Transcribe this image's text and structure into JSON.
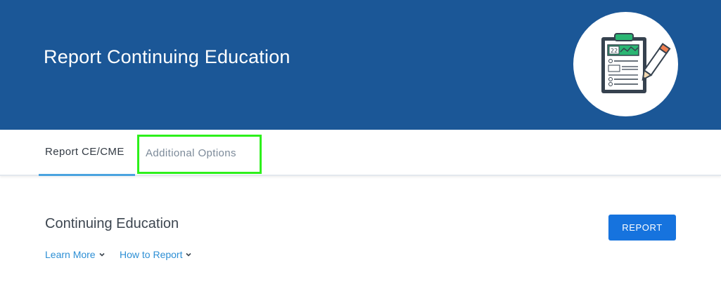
{
  "header": {
    "title": "Report Continuing Education",
    "badge_icon": "clipboard-chart-pencil-icon",
    "badge_text": "22",
    "background_color": "#1b5797"
  },
  "tabs": [
    {
      "label": "Report CE/CME",
      "active": true
    },
    {
      "label": "Additional Options",
      "active": false,
      "highlighted": true
    }
  ],
  "main": {
    "section_title": "Continuing Education",
    "report_button": "REPORT",
    "links": [
      {
        "label": "Learn More",
        "icon": "chevron-down-icon"
      },
      {
        "label": "How to Report",
        "icon": "chevron-down-icon"
      }
    ]
  },
  "colors": {
    "accent": "#1673de",
    "link": "#2d8fd5",
    "highlight": "#2df01b"
  }
}
